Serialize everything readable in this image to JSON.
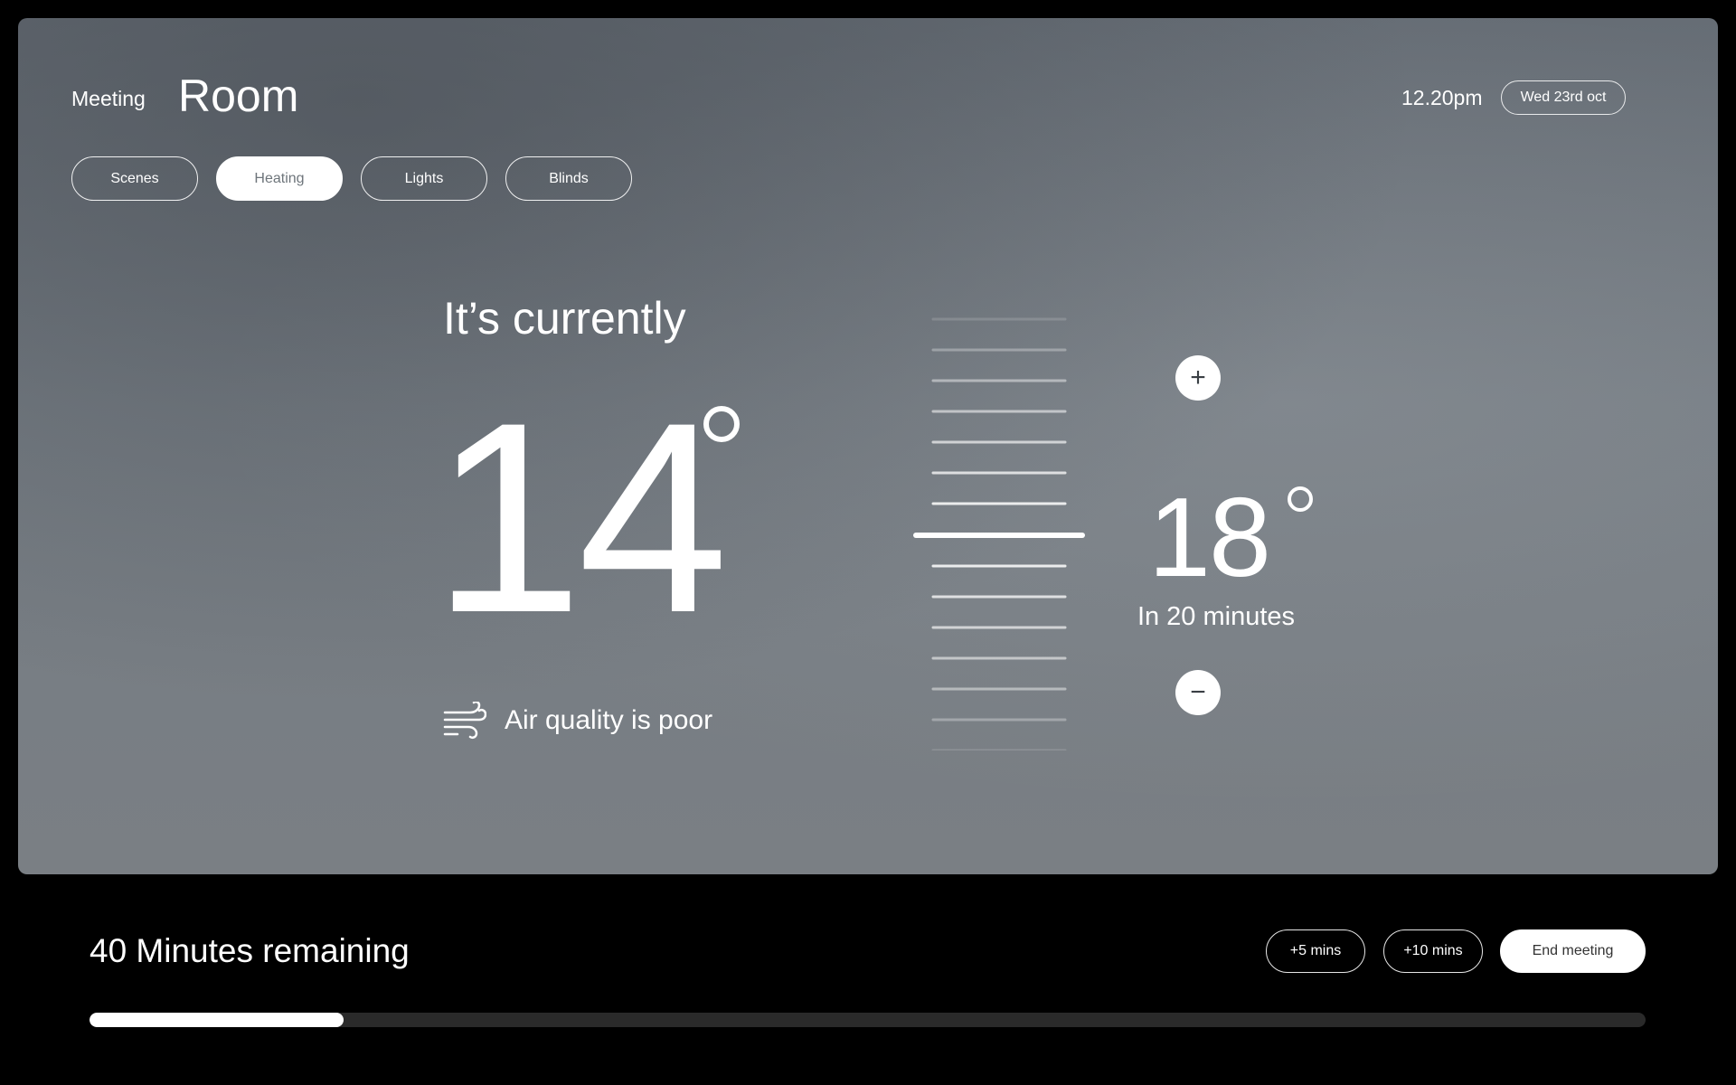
{
  "header": {
    "title_small": "Meeting",
    "title_large": "Room",
    "time": "12.20pm",
    "date": "Wed 23rd oct"
  },
  "tabs": [
    {
      "label": "Scenes",
      "active": false
    },
    {
      "label": "Heating",
      "active": true
    },
    {
      "label": "Lights",
      "active": false
    },
    {
      "label": "Blinds",
      "active": false
    }
  ],
  "current": {
    "label": "It’s currently",
    "temperature": "14",
    "air_quality": "Air quality is poor"
  },
  "target": {
    "temperature": "18",
    "subtitle": "In 20 minutes",
    "plus_symbol": "+",
    "minus_symbol": "−"
  },
  "footer": {
    "remaining": "40 Minutes remaining",
    "buttons": {
      "add5": "+5 mins",
      "add10": "+10 mins",
      "end": "End meeting"
    },
    "progress_fraction": 0.163
  },
  "icons": {
    "air": "wind-icon",
    "plus": "plus-icon",
    "minus": "minus-icon"
  },
  "colors": {
    "active_tab_text": "#6e757b",
    "background": "#000000",
    "progress_fill": "#ffffff",
    "progress_track": "#2a2a2a"
  }
}
